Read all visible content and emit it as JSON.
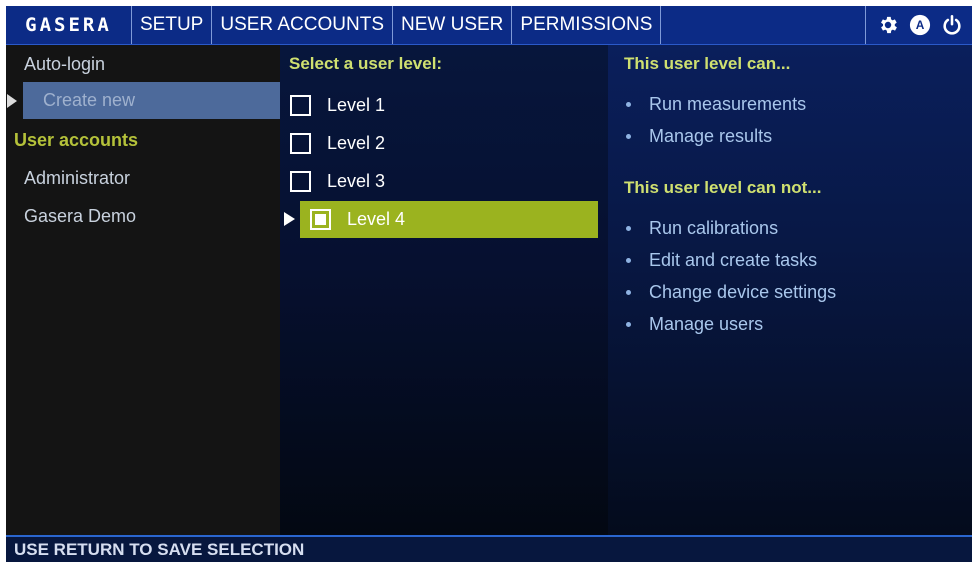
{
  "topbar": {
    "logo": "GASERA",
    "tabs": [
      "SETUP",
      "USER ACCOUNTS",
      "NEW USER",
      "PERMISSIONS"
    ],
    "icons": [
      "gear-icon",
      "user-a-icon",
      "power-icon"
    ]
  },
  "sidebar": {
    "autologin": "Auto-login",
    "create_new": "Create new",
    "accounts_header": "User accounts",
    "accounts": [
      "Administrator",
      "Gasera Demo"
    ]
  },
  "levels": {
    "heading": "Select a user level:",
    "items": [
      "Level 1",
      "Level 2",
      "Level 3",
      "Level 4"
    ],
    "selected": "Level 4"
  },
  "permissions": {
    "can_heading": "This user level can...",
    "can": [
      "Run measurements",
      "Manage results"
    ],
    "cannot_heading": "This user level can not...",
    "cannot": [
      "Run calibrations",
      "Edit and create tasks",
      "Change device settings",
      "Manage users"
    ]
  },
  "status": {
    "hint": "USE RETURN TO SAVE SELECTION"
  },
  "colors": {
    "topbar": "#0c2b86",
    "accent_green": "#9bb31f",
    "heading_yellow": "#cfe070",
    "link_blue": "#a9c7ec"
  }
}
